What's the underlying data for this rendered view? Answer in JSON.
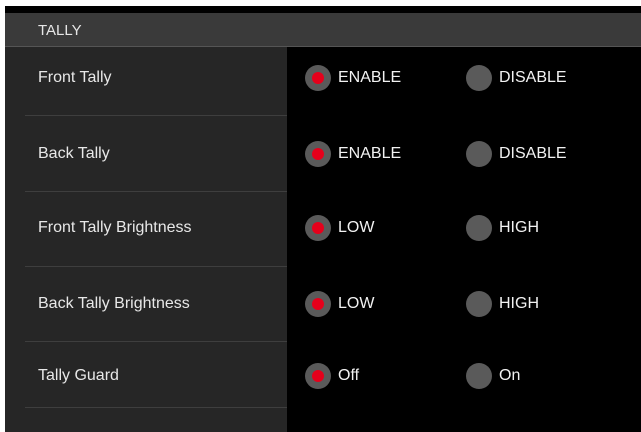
{
  "section": {
    "title": "TALLY"
  },
  "rows": [
    {
      "label": "Front Tally",
      "options": [
        {
          "label": "ENABLE",
          "selected": true
        },
        {
          "label": "DISABLE",
          "selected": false
        }
      ]
    },
    {
      "label": "Back Tally",
      "options": [
        {
          "label": "ENABLE",
          "selected": true
        },
        {
          "label": "DISABLE",
          "selected": false
        }
      ]
    },
    {
      "label": "Front Tally Brightness",
      "options": [
        {
          "label": "LOW",
          "selected": true
        },
        {
          "label": "HIGH",
          "selected": false
        }
      ]
    },
    {
      "label": "Back Tally Brightness",
      "options": [
        {
          "label": "LOW",
          "selected": true
        },
        {
          "label": "HIGH",
          "selected": false
        }
      ]
    },
    {
      "label": "Tally Guard",
      "options": [
        {
          "label": "Off",
          "selected": true
        },
        {
          "label": "On",
          "selected": false
        }
      ]
    }
  ],
  "colors": {
    "selected_dot": "#e5001b",
    "radio_bg": "#5a5a5a",
    "label_bg": "#262626",
    "header_bg": "#3a3a3a"
  }
}
